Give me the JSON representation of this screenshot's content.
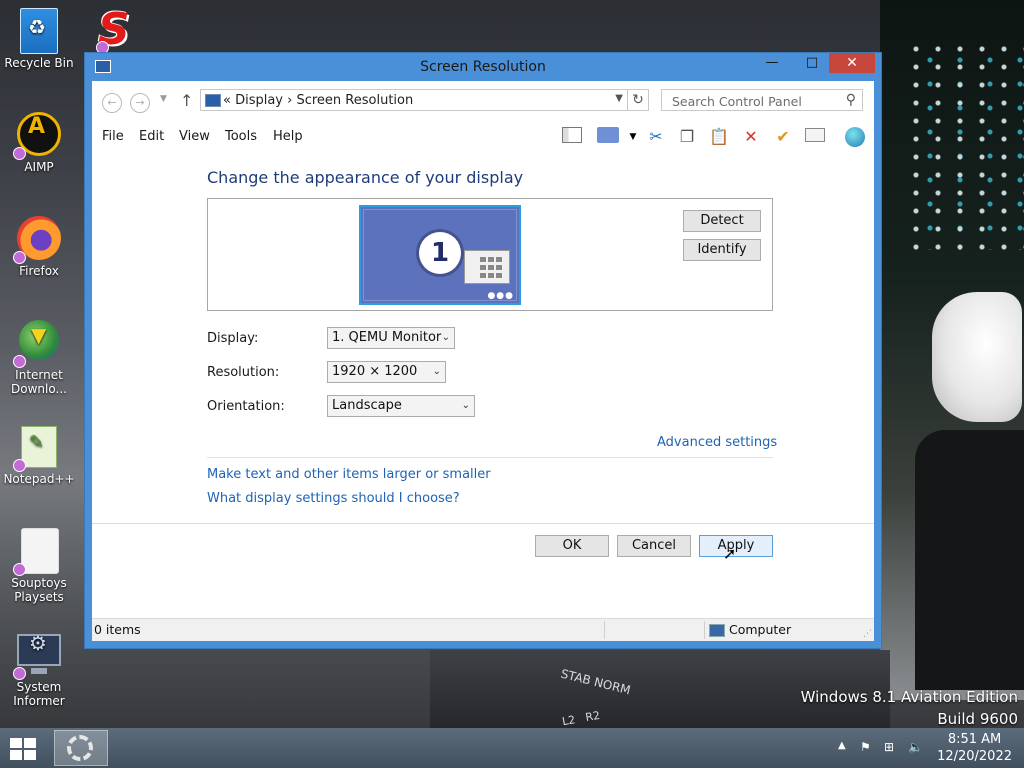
{
  "window": {
    "title": "Screen Resolution"
  },
  "address": {
    "path": "« Display  ›  Screen Resolution"
  },
  "search": {
    "placeholder": "Search Control Panel"
  },
  "menu": {
    "items": [
      "File",
      "Edit",
      "View",
      "Tools",
      "Help"
    ]
  },
  "content": {
    "heading": "Change the appearance of your display",
    "monitor_number": "1",
    "detect_button": "Detect",
    "identify_button": "Identify",
    "display": {
      "label": "Display:",
      "value": "1. QEMU Monitor"
    },
    "resolution": {
      "label": "Resolution:",
      "value": "1920 × 1200"
    },
    "orientation": {
      "label": "Orientation:",
      "value": "Landscape"
    },
    "advanced_link": "Advanced settings",
    "link_text_size": "Make text and other items larger or smaller",
    "link_help": "What display settings should I choose?"
  },
  "buttons": {
    "ok": "OK",
    "cancel": "Cancel",
    "apply": "Apply"
  },
  "statusbar": {
    "items": "0 items",
    "location": "Computer"
  },
  "desktop": {
    "icons": [
      "Recycle Bin",
      "AIMP",
      "Firefox",
      "Internet Downlo...",
      "Notepad++",
      "Souptoys Playsets",
      "System Informer"
    ]
  },
  "watermark": {
    "line1": "Windows 8.1 Aviation Edition",
    "line2": "Build 9600"
  },
  "taskbar": {
    "time": "8:51 AM",
    "date": "12/20/2022"
  },
  "colors": {
    "window_frame": "#4a90d9",
    "link": "#1f63b4",
    "heading": "#1e3d78",
    "close": "#c7473d"
  }
}
